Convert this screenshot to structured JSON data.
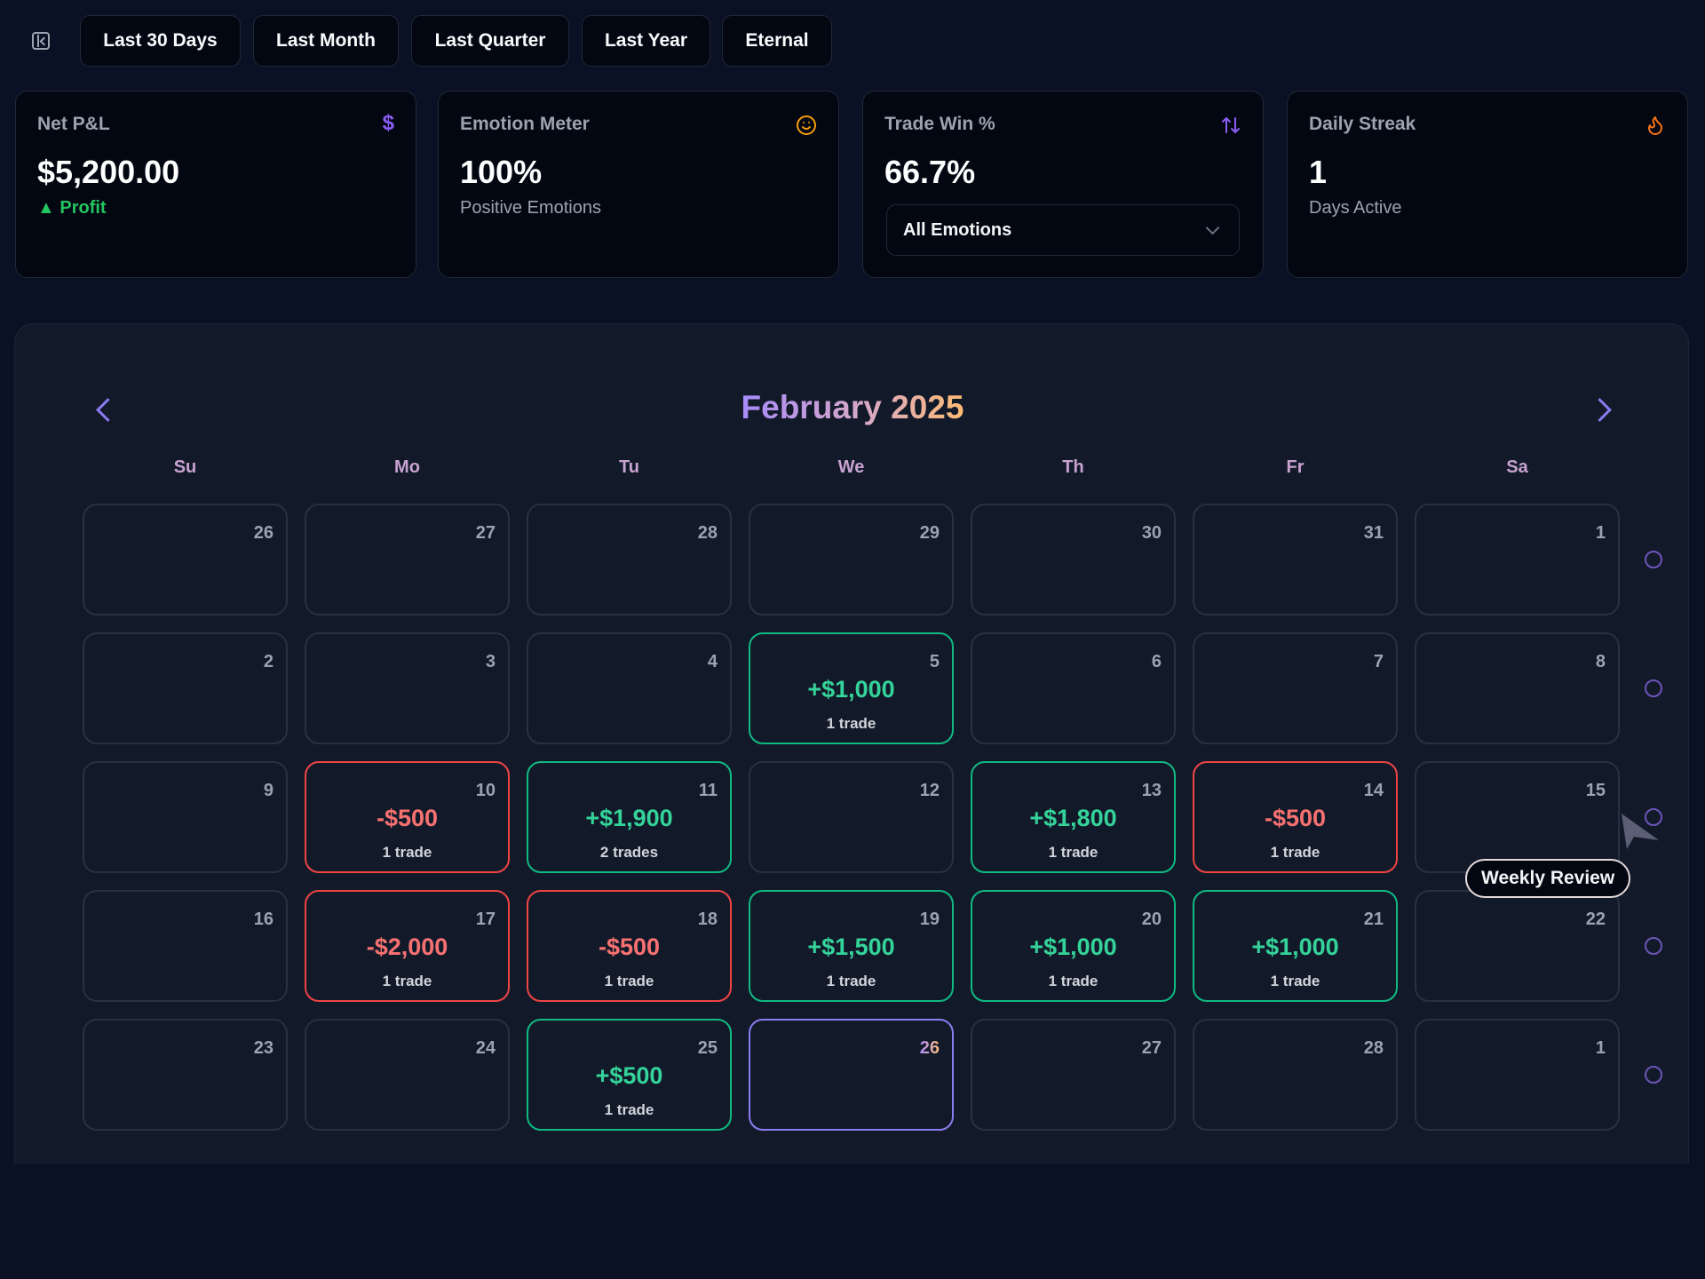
{
  "toolbar": {
    "sidebar_toggle_icon": "sidebar-collapse-icon",
    "filters": [
      {
        "label": "Last 30 Days"
      },
      {
        "label": "Last Month"
      },
      {
        "label": "Last Quarter"
      },
      {
        "label": "Last Year"
      },
      {
        "label": "Eternal"
      }
    ]
  },
  "cards": {
    "net_pnl": {
      "title": "Net P&L",
      "icon": "dollar-icon",
      "value": "$5,200.00",
      "sub": "▲ Profit"
    },
    "emotion": {
      "title": "Emotion Meter",
      "icon": "smiley-icon",
      "value": "100%",
      "sub": "Positive Emotions"
    },
    "win_rate": {
      "title": "Trade Win %",
      "icon": "sort-arrows-icon",
      "value": "66.7%",
      "filter_selected": "All Emotions"
    },
    "streak": {
      "title": "Daily Streak",
      "icon": "flame-icon",
      "value": "1",
      "sub": "Days Active"
    }
  },
  "calendar": {
    "title": "February 2025",
    "weekdays": [
      "Su",
      "Mo",
      "Tu",
      "We",
      "Th",
      "Fr",
      "Sa"
    ],
    "weeks": [
      [
        {
          "day": "26"
        },
        {
          "day": "27"
        },
        {
          "day": "28"
        },
        {
          "day": "29"
        },
        {
          "day": "30"
        },
        {
          "day": "31"
        },
        {
          "day": "1"
        }
      ],
      [
        {
          "day": "2"
        },
        {
          "day": "3"
        },
        {
          "day": "4"
        },
        {
          "day": "5",
          "pnl": "+$1,000",
          "trades": "1 trade",
          "status": "profit"
        },
        {
          "day": "6"
        },
        {
          "day": "7"
        },
        {
          "day": "8"
        }
      ],
      [
        {
          "day": "9"
        },
        {
          "day": "10",
          "pnl": "-$500",
          "trades": "1 trade",
          "status": "loss"
        },
        {
          "day": "11",
          "pnl": "+$1,900",
          "trades": "2 trades",
          "status": "profit"
        },
        {
          "day": "12"
        },
        {
          "day": "13",
          "pnl": "+$1,800",
          "trades": "1 trade",
          "status": "profit"
        },
        {
          "day": "14",
          "pnl": "-$500",
          "trades": "1 trade",
          "status": "loss"
        },
        {
          "day": "15"
        }
      ],
      [
        {
          "day": "16"
        },
        {
          "day": "17",
          "pnl": "-$2,000",
          "trades": "1 trade",
          "status": "loss"
        },
        {
          "day": "18",
          "pnl": "-$500",
          "trades": "1 trade",
          "status": "loss"
        },
        {
          "day": "19",
          "pnl": "+$1,500",
          "trades": "1 trade",
          "status": "profit"
        },
        {
          "day": "20",
          "pnl": "+$1,000",
          "trades": "1 trade",
          "status": "profit"
        },
        {
          "day": "21",
          "pnl": "+$1,000",
          "trades": "1 trade",
          "status": "profit"
        },
        {
          "day": "22"
        }
      ],
      [
        {
          "day": "23"
        },
        {
          "day": "24"
        },
        {
          "day": "25",
          "pnl": "+$500",
          "trades": "1 trade",
          "status": "profit"
        },
        {
          "day": "26",
          "status": "today"
        },
        {
          "day": "27"
        },
        {
          "day": "28"
        },
        {
          "day": "1"
        }
      ]
    ],
    "weekly_review_tooltip": "Weekly Review"
  },
  "colors": {
    "profit": "#10b981",
    "loss": "#ef4444",
    "today": "#8b7cf0",
    "accent_purple": "#a78bfa",
    "accent_orange": "#f97316"
  }
}
